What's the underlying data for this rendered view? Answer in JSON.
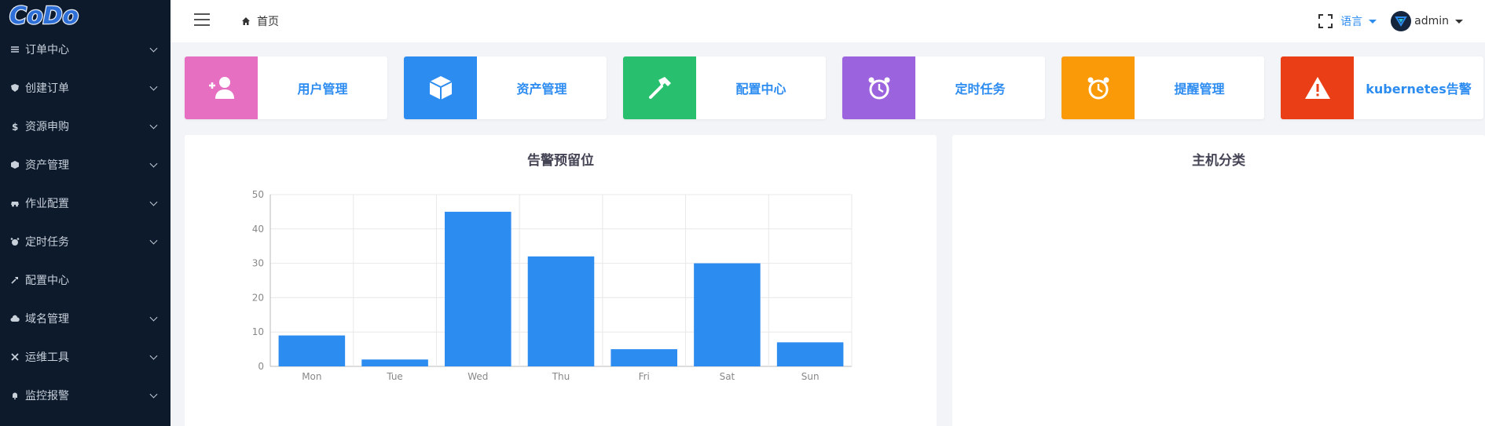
{
  "app": {
    "logo_text": "CoDo"
  },
  "sidebar": {
    "items": [
      {
        "label": "订单中心",
        "icon": "list-icon",
        "expandable": true
      },
      {
        "label": "创建订单",
        "icon": "shield-icon",
        "expandable": true
      },
      {
        "label": "资源申购",
        "icon": "dollar-icon",
        "expandable": true
      },
      {
        "label": "资产管理",
        "icon": "cube-icon",
        "expandable": true
      },
      {
        "label": "作业配置",
        "icon": "car-icon",
        "expandable": true
      },
      {
        "label": "定时任务",
        "icon": "alarm-icon",
        "expandable": true
      },
      {
        "label": "配置中心",
        "icon": "hammer-icon",
        "expandable": false
      },
      {
        "label": "域名管理",
        "icon": "cloud-icon",
        "expandable": true
      },
      {
        "label": "运维工具",
        "icon": "tools-icon",
        "expandable": true
      },
      {
        "label": "监控报警",
        "icon": "bell-icon",
        "expandable": true
      }
    ]
  },
  "header": {
    "breadcrumb": "首页",
    "language": "语言",
    "user": "admin"
  },
  "cards": [
    {
      "label": "用户管理",
      "icon": "add-user-icon",
      "color": "#e76fc2"
    },
    {
      "label": "资产管理",
      "icon": "cube-icon",
      "color": "#2d8cf0"
    },
    {
      "label": "配置中心",
      "icon": "hammer-icon",
      "color": "#28c06e"
    },
    {
      "label": "定时任务",
      "icon": "alarm-clock-icon",
      "color": "#9b64de"
    },
    {
      "label": "提醒管理",
      "icon": "alarm-clock-icon",
      "color": "#fb9a08"
    },
    {
      "label": "kubernetes告警",
      "icon": "warning-icon",
      "color": "#ea3f16"
    }
  ],
  "panels": {
    "alert_title": "告警预留位",
    "host_title": "主机分类"
  },
  "chart_data": {
    "type": "bar",
    "title": "告警预留位",
    "categories": [
      "Mon",
      "Tue",
      "Wed",
      "Thu",
      "Fri",
      "Sat",
      "Sun"
    ],
    "values": [
      9,
      2,
      45,
      32,
      5,
      30,
      7
    ],
    "ylim": [
      0,
      50
    ],
    "yticks": [
      0,
      10,
      20,
      30,
      40,
      50
    ],
    "grid": true,
    "bar_color": "#2d8cf0"
  }
}
